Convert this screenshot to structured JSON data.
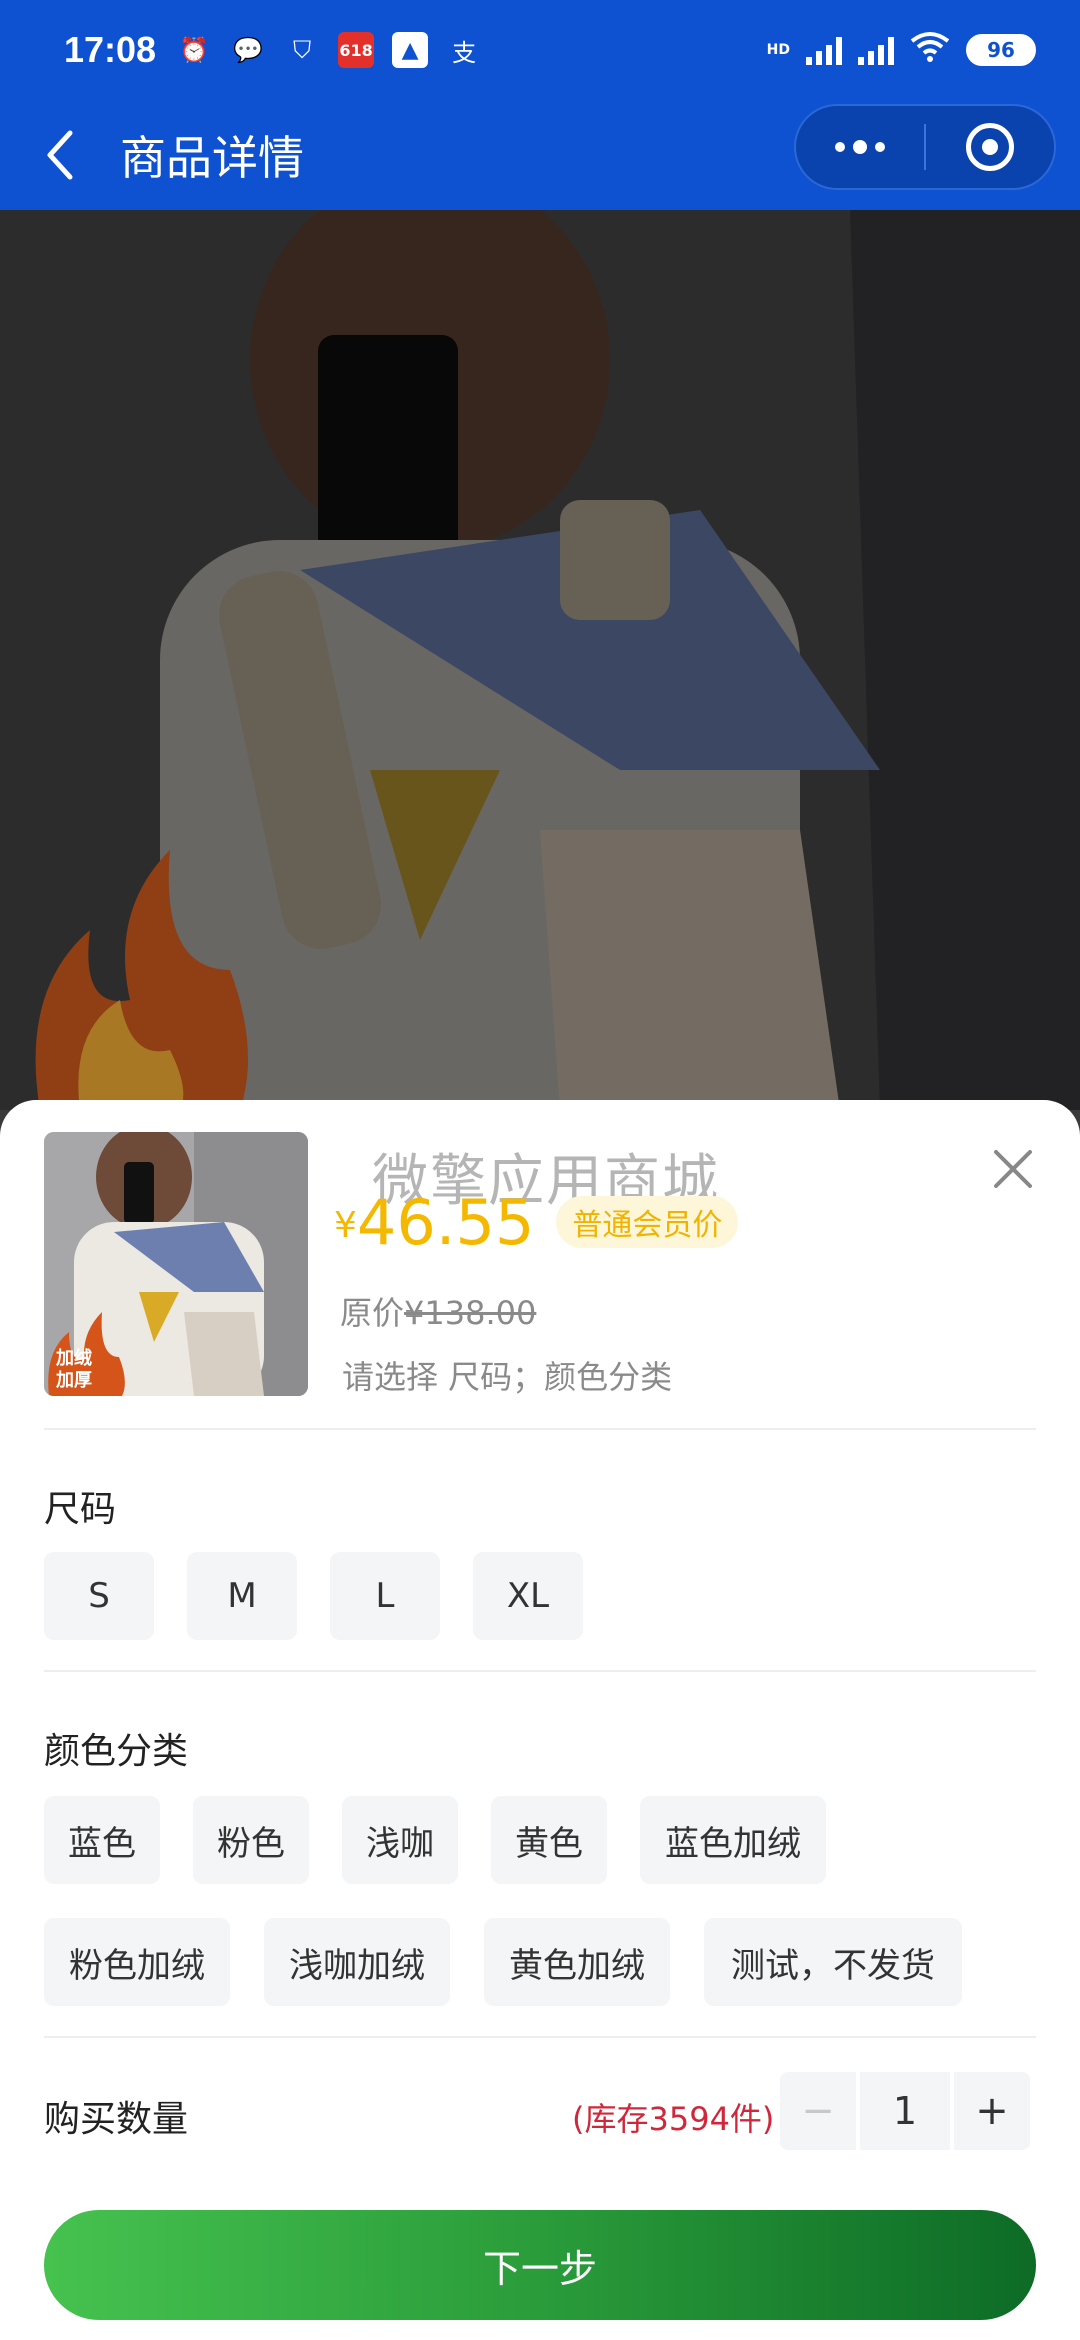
{
  "status_bar": {
    "time": "17:08",
    "battery": "96",
    "network_label": "HD",
    "app_icon_618": "618",
    "app_icon_zhi": "支"
  },
  "nav": {
    "title": "商品详情"
  },
  "sheet": {
    "watermark": "微擎应用商城",
    "price_symbol": "¥",
    "price": "46.55",
    "member_badge": "普通会员价",
    "orig_price_prefix": "原价",
    "orig_price": "¥138.00",
    "select_hint": "请选择 尺码；颜色分类",
    "thumb_badge_line1": "加绒",
    "thumb_badge_line2": "加厚",
    "size_title": "尺码",
    "sizes": [
      "S",
      "M",
      "L",
      "XL"
    ],
    "color_title": "颜色分类",
    "colors": [
      "蓝色",
      "粉色",
      "浅咖",
      "黄色",
      "蓝色加绒",
      "粉色加绒",
      "浅咖加绒",
      "黄色加绒",
      "测试，不发货"
    ],
    "qty_label": "购买数量",
    "stock": "(库存3594件)",
    "qty_minus": "−",
    "qty_value": "1",
    "qty_plus": "+",
    "next_button": "下一步"
  }
}
